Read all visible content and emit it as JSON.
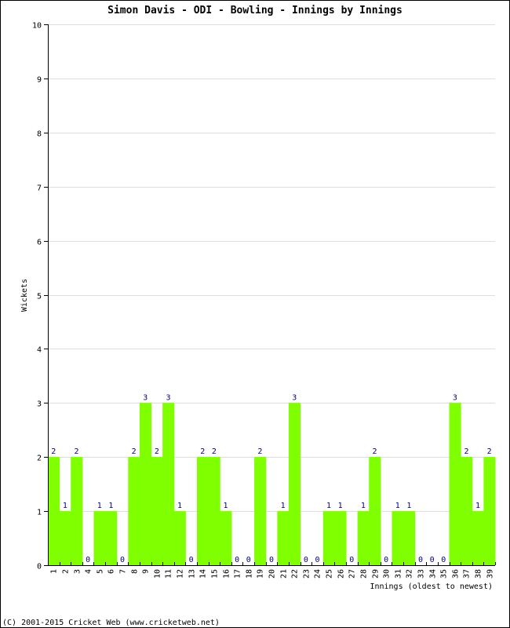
{
  "chart_data": {
    "type": "bar",
    "title": "Simon Davis - ODI - Bowling - Innings by Innings",
    "xlabel": "Innings (oldest to newest)",
    "ylabel": "Wickets",
    "ylim": [
      0,
      10
    ],
    "yticks": [
      0,
      1,
      2,
      3,
      4,
      5,
      6,
      7,
      8,
      9,
      10
    ],
    "grid": true,
    "bar_color": "#80ff00",
    "label_color": "#000080",
    "categories": [
      "1",
      "2",
      "3",
      "4",
      "5",
      "6",
      "7",
      "8",
      "9",
      "10",
      "11",
      "12",
      "13",
      "14",
      "15",
      "16",
      "17",
      "18",
      "19",
      "20",
      "21",
      "22",
      "23",
      "24",
      "25",
      "26",
      "27",
      "28",
      "29",
      "30",
      "31",
      "32",
      "33",
      "34",
      "35",
      "36",
      "37",
      "38",
      "39"
    ],
    "values": [
      2,
      1,
      2,
      0,
      1,
      1,
      0,
      2,
      3,
      2,
      3,
      1,
      0,
      2,
      2,
      1,
      0,
      0,
      2,
      0,
      1,
      3,
      0,
      0,
      1,
      1,
      0,
      1,
      2,
      0,
      1,
      1,
      0,
      0,
      0,
      3,
      2,
      1,
      2
    ]
  },
  "footer": "(C) 2001-2015 Cricket Web (www.cricketweb.net)"
}
